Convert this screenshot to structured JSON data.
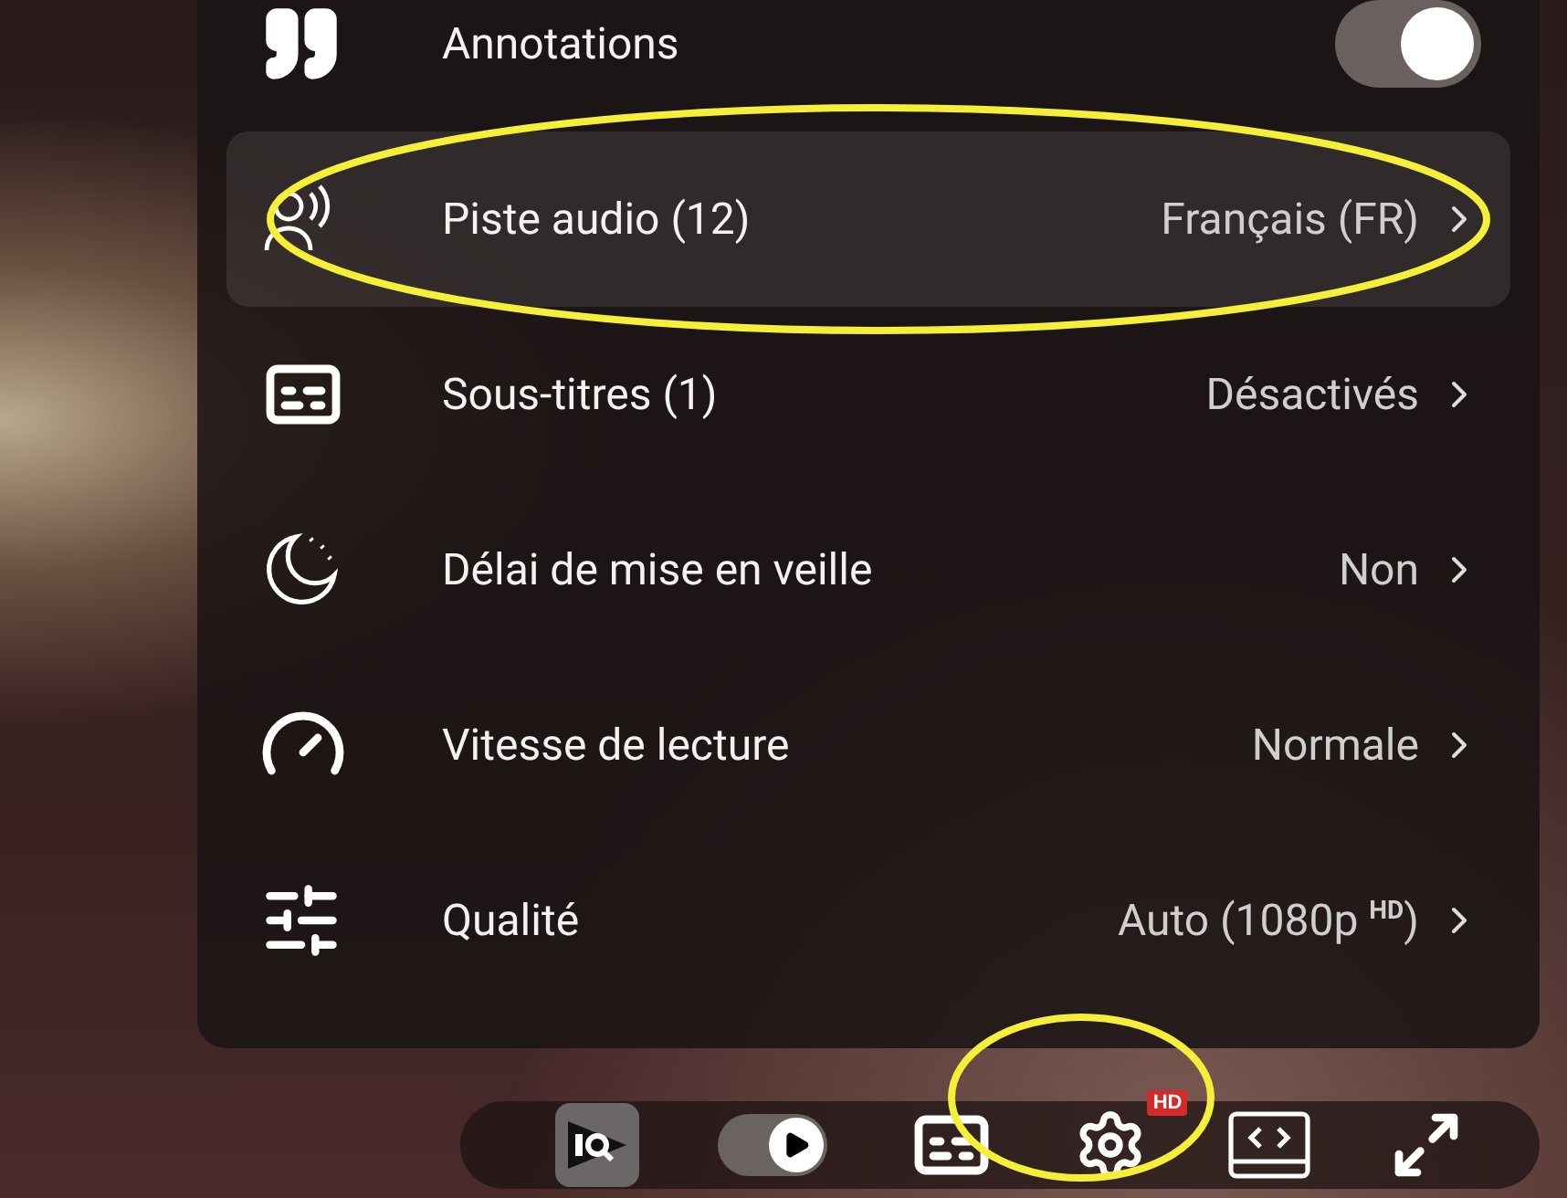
{
  "settings_menu": {
    "rows": [
      {
        "kind": "toggle",
        "label": "Annotations",
        "on": true,
        "selected": false
      },
      {
        "kind": "submenu",
        "label": "Piste audio (12)",
        "value": "Français (FR)",
        "selected": true
      },
      {
        "kind": "submenu",
        "label": "Sous-titres (1)",
        "value": "Désactivés",
        "selected": false
      },
      {
        "kind": "submenu",
        "label": "Délai de mise en veille",
        "value": "Non",
        "selected": false
      },
      {
        "kind": "submenu",
        "label": "Vitesse de lecture",
        "value": "Normale",
        "selected": false
      },
      {
        "kind": "submenu",
        "label": "Qualité",
        "value": "Auto (1080p $^{HD}$)",
        "selected": false
      }
    ]
  },
  "player_bar": {
    "autoplay_on": true,
    "quality_badge": "HD"
  }
}
